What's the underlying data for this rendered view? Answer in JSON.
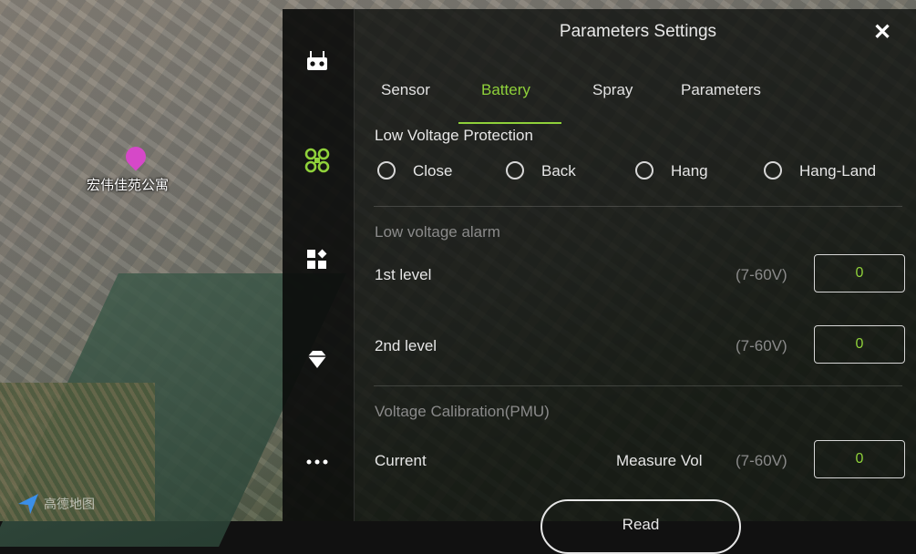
{
  "map": {
    "poi_label": "宏伟佳苑公寓",
    "logo_text": "高德地图"
  },
  "rail": {
    "icons": [
      "remote-controller-icon",
      "drone-icon",
      "apps-icon",
      "diamond-icon",
      "more-icon"
    ]
  },
  "panel": {
    "title": "Parameters Settings",
    "close_label": "✕"
  },
  "tabs": [
    {
      "label": "Sensor",
      "active": false
    },
    {
      "label": "Battery",
      "active": true
    },
    {
      "label": "Spray",
      "active": false
    },
    {
      "label": "Parameters",
      "active": false
    }
  ],
  "low_voltage_protection": {
    "title": "Low Voltage Protection",
    "options": [
      "Close",
      "Back",
      "Hang",
      "Hang-Land"
    ]
  },
  "low_voltage_alarm": {
    "title": "Low voltage alarm",
    "levels": [
      {
        "label": "1st level",
        "range": "(7-60V)",
        "value": "0"
      },
      {
        "label": "2nd level",
        "range": "(7-60V)",
        "value": "0"
      }
    ]
  },
  "voltage_calibration": {
    "title": "Voltage Calibration(PMU)",
    "current_label": "Current",
    "measure_label": "Measure Vol",
    "range": "(7-60V)",
    "value": "0"
  },
  "read_button": "Read",
  "colors": {
    "accent": "#8fd13a",
    "text": "#e6e6e6",
    "muted": "#8a8a8a"
  }
}
